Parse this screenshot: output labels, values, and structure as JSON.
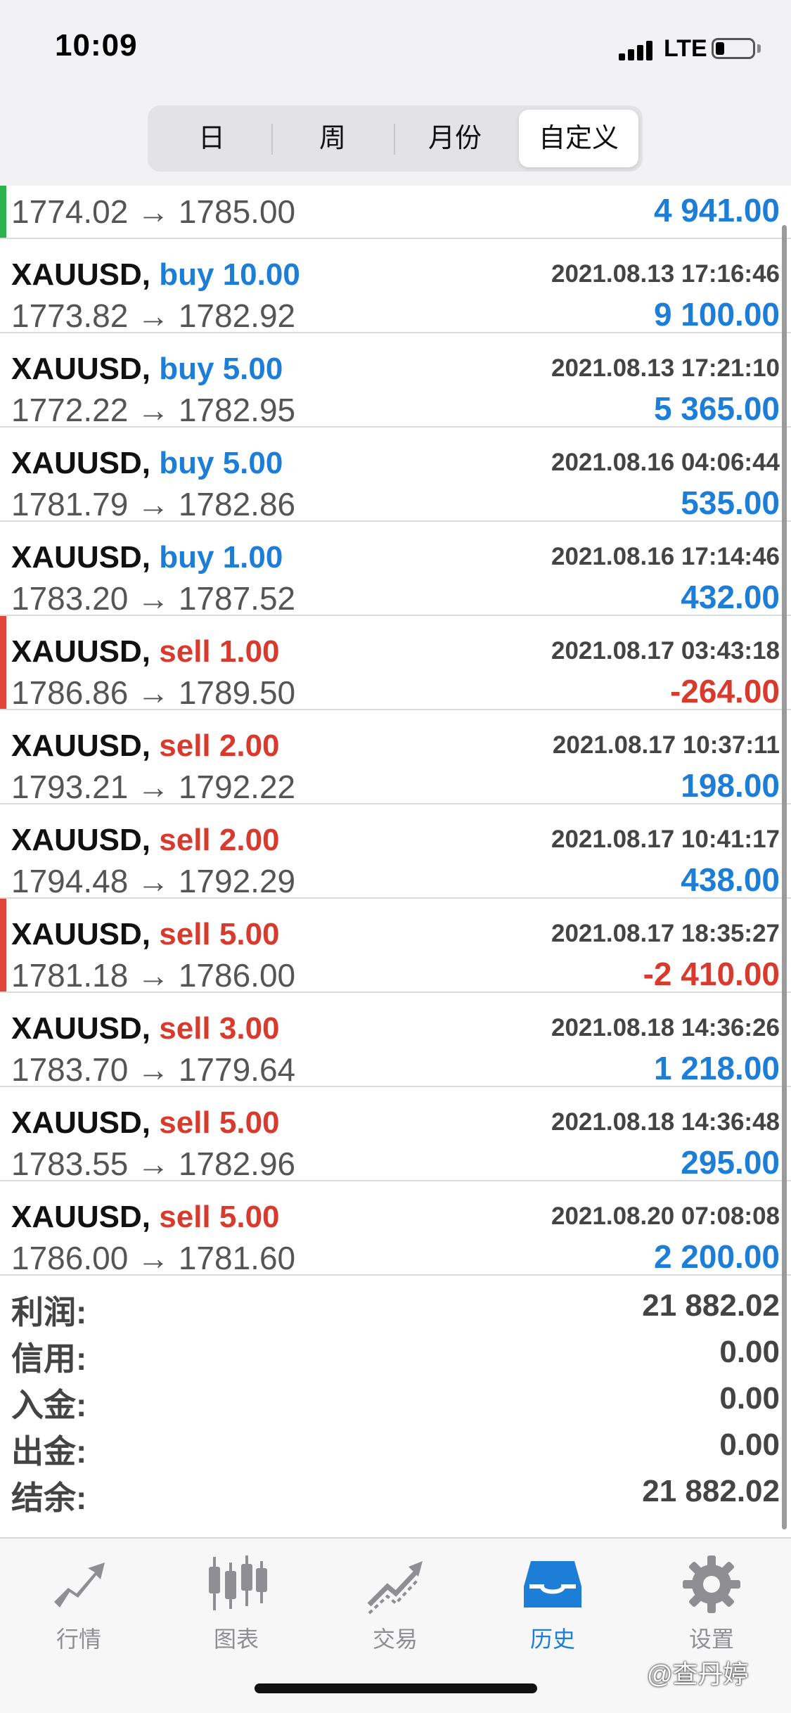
{
  "status_bar": {
    "time": "10:09",
    "network": "LTE"
  },
  "tabs": [
    "日",
    "周",
    "月份",
    "自定义"
  ],
  "active_tab": "自定义",
  "partial_row": {
    "prices": "1774.02 → 1785.00",
    "profit": "4 941.00",
    "status_color": "#2bb24c"
  },
  "deals": [
    {
      "symbol": "XAUUSD,",
      "side": "buy 10.00",
      "time": "2021.08.13 17:16:46",
      "prices": "1773.82 → 1782.92",
      "profit": "9 100.00"
    },
    {
      "symbol": "XAUUSD,",
      "side": "buy 5.00",
      "time": "2021.08.13 17:21:10",
      "prices": "1772.22 → 1782.95",
      "profit": "5 365.00"
    },
    {
      "symbol": "XAUUSD,",
      "side": "buy 5.00",
      "time": "2021.08.16 04:06:44",
      "prices": "1781.79 → 1782.86",
      "profit": "535.00"
    },
    {
      "symbol": "XAUUSD,",
      "side": "buy 1.00",
      "time": "2021.08.16 17:14:46",
      "prices": "1783.20 → 1787.52",
      "profit": "432.00"
    },
    {
      "symbol": "XAUUSD,",
      "side": "sell 1.00",
      "time": "2021.08.17 03:43:18",
      "prices": "1786.86 → 1789.50",
      "profit": "-264.00"
    },
    {
      "symbol": "XAUUSD,",
      "side": "sell 2.00",
      "time": "2021.08.17 10:37:11",
      "prices": "1793.21 → 1792.22",
      "profit": "198.00"
    },
    {
      "symbol": "XAUUSD,",
      "side": "sell 2.00",
      "time": "2021.08.17 10:41:17",
      "prices": "1794.48 → 1792.29",
      "profit": "438.00"
    },
    {
      "symbol": "XAUUSD,",
      "side": "sell 5.00",
      "time": "2021.08.17 18:35:27",
      "prices": "1781.18 → 1786.00",
      "profit": "-2 410.00"
    },
    {
      "symbol": "XAUUSD,",
      "side": "sell 3.00",
      "time": "2021.08.18 14:36:26",
      "prices": "1783.70 → 1779.64",
      "profit": "1 218.00"
    },
    {
      "symbol": "XAUUSD,",
      "side": "sell 5.00",
      "time": "2021.08.18 14:36:48",
      "prices": "1783.55 → 1782.96",
      "profit": "295.00"
    },
    {
      "symbol": "XAUUSD,",
      "side": "sell 5.00",
      "time": "2021.08.20 07:08:08",
      "prices": "1786.00 → 1781.60",
      "profit": "2 200.00"
    }
  ],
  "summary": [
    {
      "label": "利润:",
      "value": "21 882.02"
    },
    {
      "label": "信用:",
      "value": "0.00"
    },
    {
      "label": "入金:",
      "value": "0.00"
    },
    {
      "label": "出金:",
      "value": "0.00"
    },
    {
      "label": "结余:",
      "value": "21 882.02"
    }
  ],
  "tabbar": [
    {
      "label": "行情",
      "icon": "quotes-icon"
    },
    {
      "label": "图表",
      "icon": "chart-icon"
    },
    {
      "label": "交易",
      "icon": "trade-icon"
    },
    {
      "label": "历史",
      "icon": "history-icon"
    },
    {
      "label": "设置",
      "icon": "settings-icon"
    }
  ],
  "active_tabbar": "历史",
  "watermark": "@查丹婷",
  "colors": {
    "buy": "#1d7ed8",
    "sell": "#d93a2e",
    "loss_bar": "#e0453a",
    "profit_bar": "#2bb24c"
  }
}
